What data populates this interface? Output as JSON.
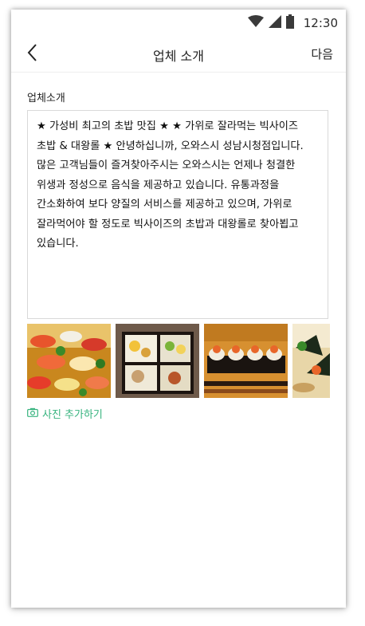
{
  "status_bar": {
    "time": "12:30",
    "icons": [
      "wifi-icon",
      "signal-icon",
      "battery-icon"
    ]
  },
  "nav": {
    "title": "업체 소개",
    "back_icon": "chevron-left-icon",
    "next_label": "다음"
  },
  "form": {
    "section_label": "업체소개",
    "description": "★ 가성비 최고의 초밥 맛집 ★ ★ 가위로 잘라먹는 빅사이즈 초밥 & 대왕롤 ★ 안녕하십니까, 오와스시 성남시청점입니다.\n많은 고객님들이 즐겨찾아주시는 오와스시는 언제나 청결한 위생과 정성으로 음식을 제공하고 있습니다. 유통과정을 간소화하여 보다 양질의 서비스를 제공하고 있으며, 가위로 잘라먹어야 할 정도로 빅사이즈의 초밥과 대왕롤로 찾아뵙고 있습니다."
  },
  "photos": [
    {
      "name": "photo-sushi-platter"
    },
    {
      "name": "photo-bento-box"
    },
    {
      "name": "photo-sushi-rolls"
    },
    {
      "name": "photo-hand-rolls"
    }
  ],
  "add_photo": {
    "label": "사진 추가하기",
    "icon": "camera-icon"
  },
  "colors": {
    "accent": "#36b37e",
    "text": "#222222",
    "border": "#d9d9d9"
  }
}
